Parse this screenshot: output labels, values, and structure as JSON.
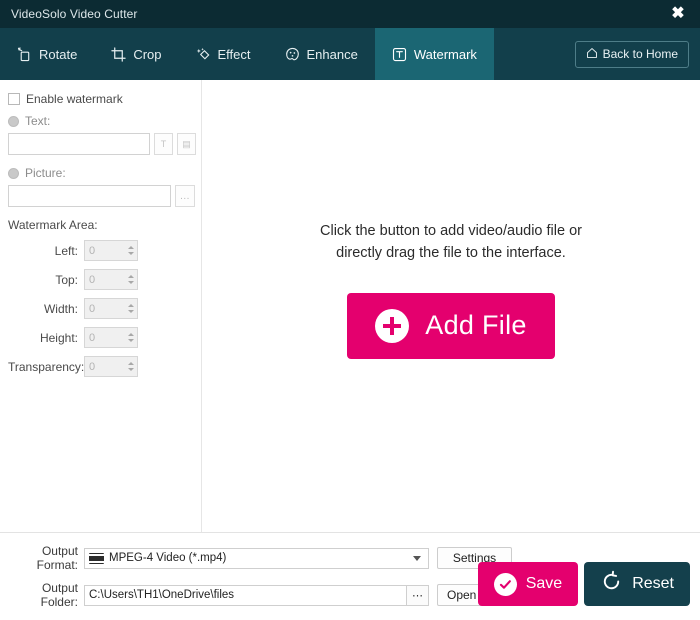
{
  "window": {
    "title": "VideoSolo Video Cutter",
    "close_label": "✖"
  },
  "toolbar": {
    "tabs": [
      {
        "label": "Rotate",
        "icon": "rotate-icon",
        "active": false
      },
      {
        "label": "Crop",
        "icon": "crop-icon",
        "active": false
      },
      {
        "label": "Effect",
        "icon": "effect-icon",
        "active": false
      },
      {
        "label": "Enhance",
        "icon": "enhance-icon",
        "active": false
      },
      {
        "label": "Watermark",
        "icon": "watermark-icon",
        "active": true
      }
    ],
    "back_home_label": "Back to Home",
    "back_home_icon": "home-icon"
  },
  "watermark_panel": {
    "enable_label": "Enable watermark",
    "enable_checked": false,
    "text_option_label": "Text:",
    "text_value": "",
    "text_placeholder": "",
    "font_button_label": "T",
    "color_button_label": "▤",
    "picture_option_label": "Picture:",
    "picture_value": "",
    "picture_placeholder": "",
    "browse_button_label": "...",
    "area_title": "Watermark Area:",
    "fields": [
      {
        "label": "Left:",
        "value": "0"
      },
      {
        "label": "Top:",
        "value": "0"
      },
      {
        "label": "Width:",
        "value": "0"
      },
      {
        "label": "Height:",
        "value": "0"
      },
      {
        "label": "Transparency:",
        "value": "0"
      }
    ]
  },
  "preview": {
    "hint_line1": "Click the button to add video/audio file or",
    "hint_line2": "directly drag the file to the interface.",
    "add_file_label": "Add File",
    "add_file_icon": "plus-circle-icon"
  },
  "footer": {
    "output_format_label": "Output Format:",
    "output_format_value": "MPEG-4 Video (*.mp4)",
    "format_icon": "film-strip-icon",
    "settings_label": "Settings",
    "output_folder_label": "Output Folder:",
    "output_folder_value": "C:\\Users\\TH1\\OneDrive\\files",
    "output_folder_placeholder": "",
    "folder_browse_label": "⋯",
    "open_folder_label": "Open Folder",
    "save_label": "Save",
    "save_icon": "check-circle-icon",
    "reset_label": "Reset",
    "reset_icon": "undo-icon"
  },
  "colors": {
    "titlebar": "#0c2b33",
    "toolbar": "#123f4b",
    "active_tab": "#1b6673",
    "accent_pink": "#e4006e",
    "reset_dark": "#14404c"
  }
}
